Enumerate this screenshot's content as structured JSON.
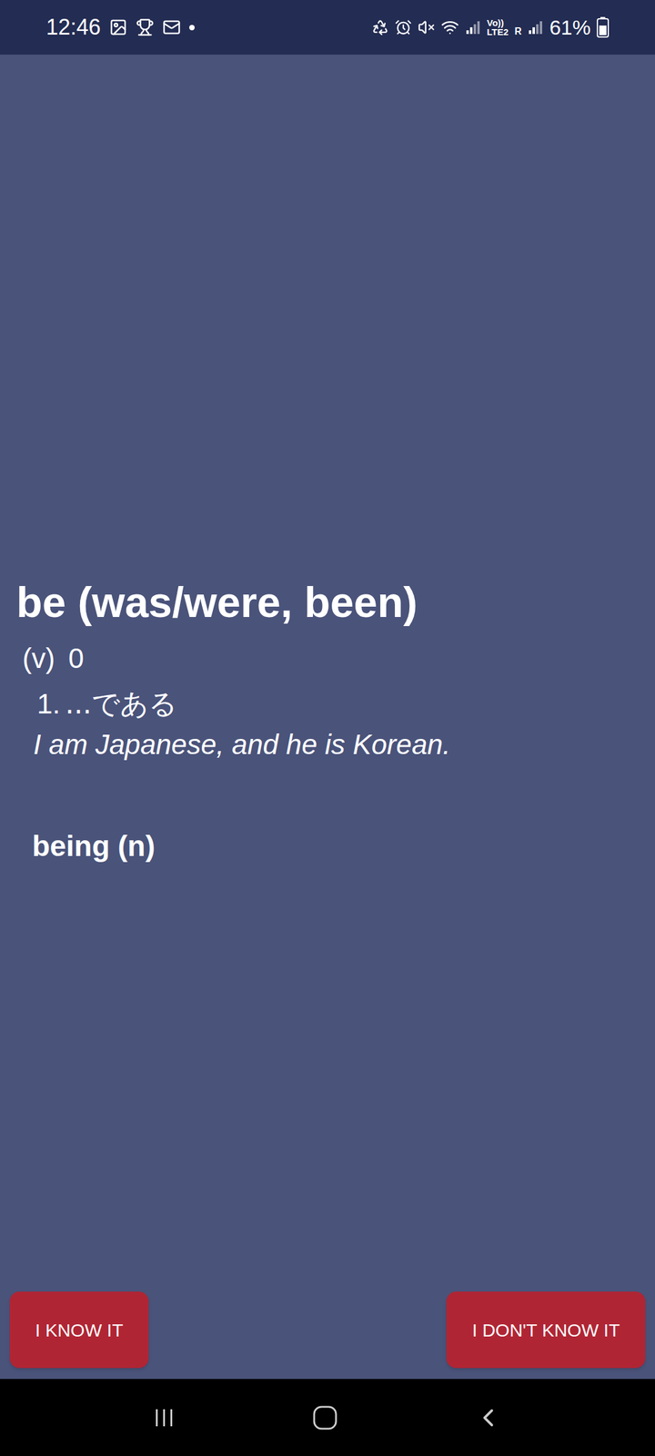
{
  "status_bar": {
    "time": "12:46",
    "network": [
      "Vo))",
      "LTE2",
      "R"
    ],
    "battery": "61%",
    "battery_level": 0.61
  },
  "entry": {
    "word": "be (was/were, been)",
    "part_of_speech": "(v)",
    "level": "0",
    "senses": [
      {
        "number": "1.",
        "meaning": "...である",
        "example": "I am Japanese, and he is Korean."
      }
    ],
    "derived": [
      {
        "word": "being (n)"
      }
    ]
  },
  "buttons": [
    {
      "label": "I KNOW IT"
    },
    {
      "label": "I DON'T KNOW IT"
    }
  ]
}
